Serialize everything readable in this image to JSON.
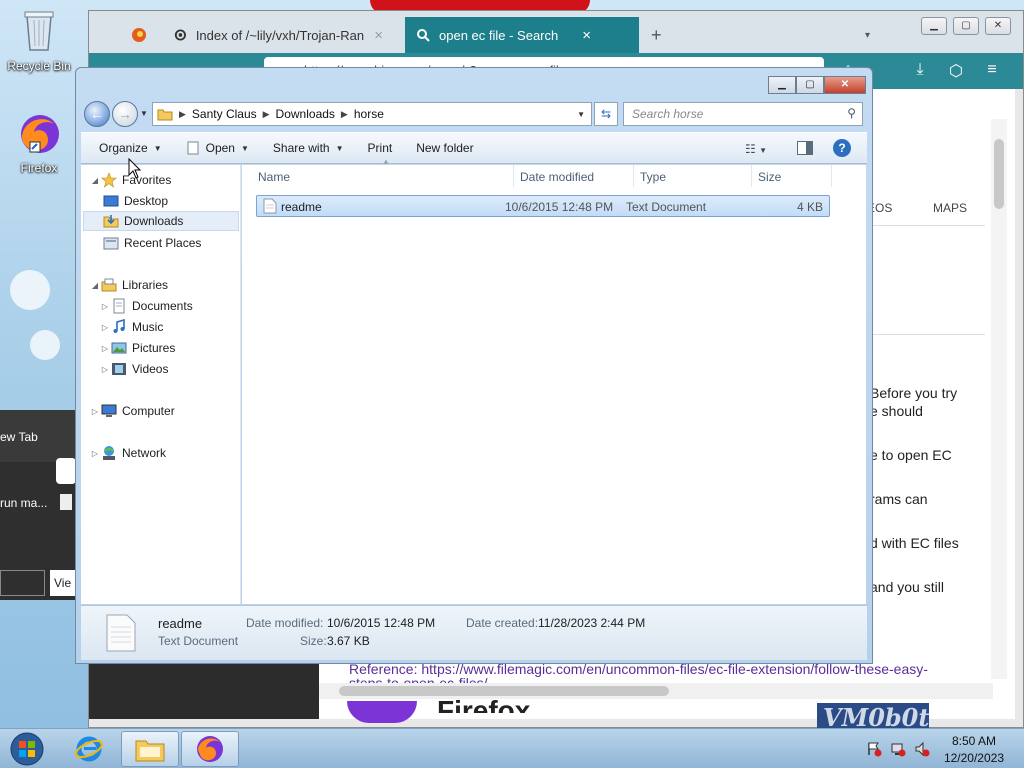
{
  "desktop": {
    "icons": [
      {
        "label": "Recycle Bin",
        "icon": "recycle-bin-icon"
      },
      {
        "label": "Firefox",
        "icon": "firefox-icon"
      }
    ],
    "partial_texts": [
      "ew Tab",
      "run ma...",
      "Vie"
    ]
  },
  "firefox": {
    "tabs": [
      {
        "label": "Index of /~lily/vxh/Trojan-Ranso",
        "icon": "gear-icon"
      },
      {
        "label": "open ec file - Search",
        "icon": "search-icon",
        "active": true
      }
    ],
    "url": "https://www.bing.com/search?q=open+ec+file",
    "page": {
      "maps_tab": "MAPS",
      "videos_tab_partial": "EOS",
      "lines": [
        "Before you try",
        "e should",
        "e to open EC",
        "rams can",
        "d with EC files",
        "and you still"
      ],
      "reference_text": "Reference: https://www.filemagic.com/en/uncommon-files/ec-file-extension/follow-these-easy-",
      "reference_cont": "steps-to-open-ec-files/",
      "brand_partial": "Firefox"
    },
    "accent_color": "#1c7f8b"
  },
  "explorer": {
    "breadcrumbs": [
      "Santy Claus",
      "Downloads",
      "horse"
    ],
    "search_placeholder": "Search horse",
    "toolbar": {
      "organize": "Organize",
      "open": "Open",
      "share_with": "Share with",
      "print": "Print",
      "new_folder": "New folder"
    },
    "nav": {
      "favorites": "Favorites",
      "desktop": "Desktop",
      "downloads": "Downloads",
      "recent_places": "Recent Places",
      "libraries": "Libraries",
      "documents": "Documents",
      "music": "Music",
      "pictures": "Pictures",
      "videos": "Videos",
      "computer": "Computer",
      "network": "Network"
    },
    "columns": {
      "name": "Name",
      "date_modified": "Date modified",
      "type": "Type",
      "size": "Size"
    },
    "files": [
      {
        "name": "readme",
        "date_modified": "10/6/2015 12:48 PM",
        "type": "Text Document",
        "size": "4 KB"
      }
    ],
    "details": {
      "name": "readme",
      "type": "Text Document",
      "date_modified_label": "Date modified:",
      "date_modified": "10/6/2015 12:48 PM",
      "size_label": "Size:",
      "size": "3.67 KB",
      "date_created_label": "Date created:",
      "date_created": "11/28/2023 2:44 PM"
    }
  },
  "taskbar": {
    "time": "8:50 AM",
    "date": "12/20/2023"
  },
  "watermark": "VM0b0t"
}
